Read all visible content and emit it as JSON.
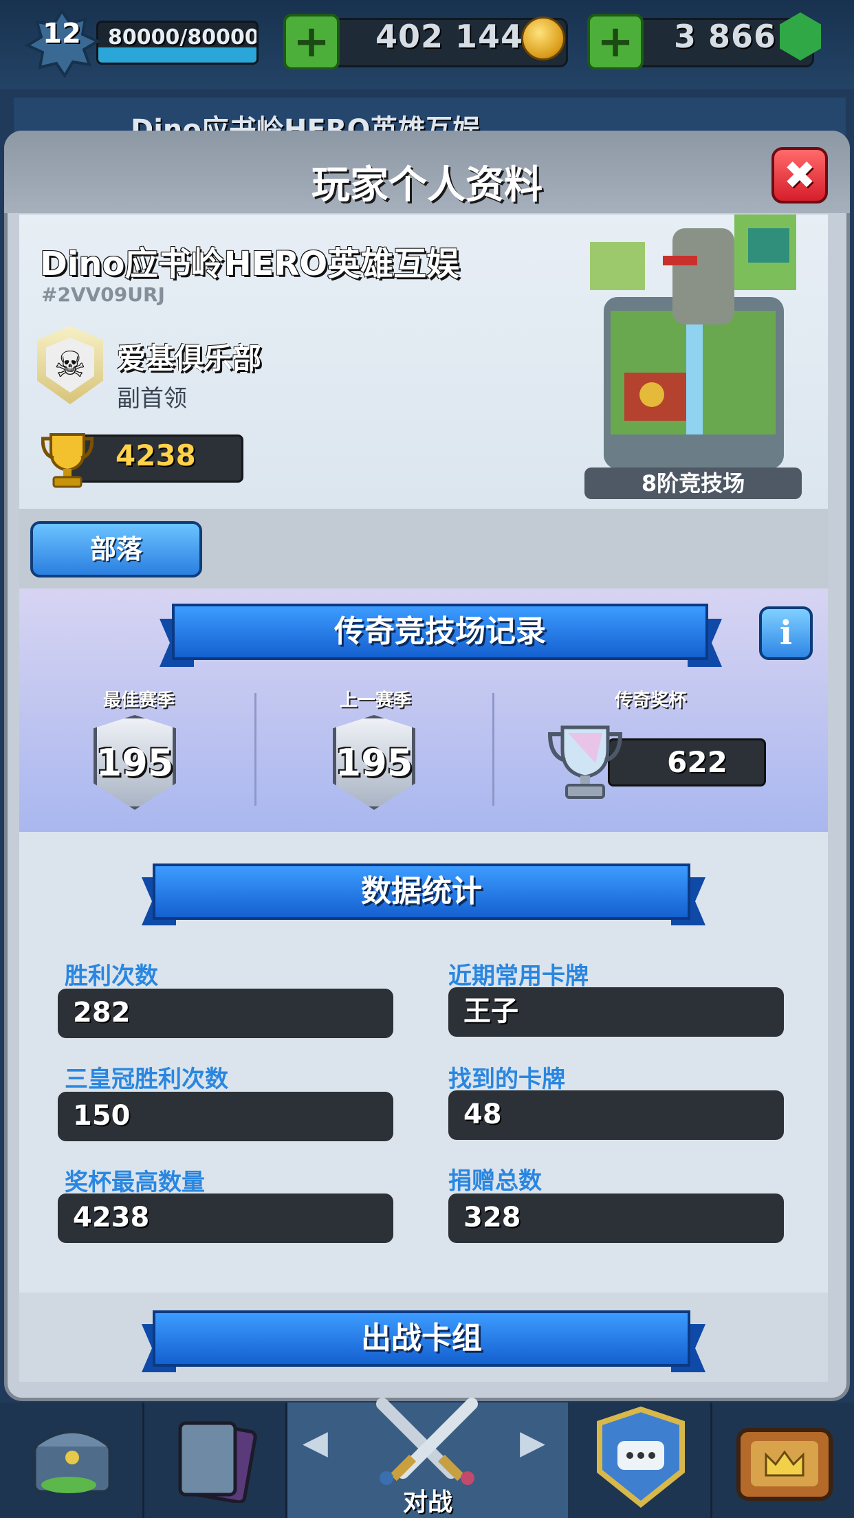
{
  "top_bar": {
    "level": "12",
    "xp_text": "80000/80000",
    "xp_progress": 1.0,
    "gold": "402 144",
    "gems": "3 866",
    "add_gold_label": "+",
    "add_gems_label": "+"
  },
  "background_strip": {
    "name_text": "Dino应书岭HERO英雄互娱"
  },
  "modal": {
    "title": "玩家个人资料",
    "close_label": "✖"
  },
  "profile": {
    "player_name": "Dino应书岭HERO英雄互娱",
    "player_tag": "#2VV09URJ",
    "clan_name": "爱基俱乐部",
    "clan_role": "副首领",
    "clan_icon": "skull-icon",
    "trophies": "4238",
    "arena_label": "8阶竞技场"
  },
  "tribe_button": "部落",
  "legend_arena": {
    "title": "传奇竞技场记录",
    "info_label": "i",
    "best_season_label": "最佳赛季",
    "best_season_value": "195",
    "last_season_label": "上一赛季",
    "last_season_value": "195",
    "legend_trophy_label": "传奇奖杯",
    "legend_trophy_value": "622"
  },
  "stats": {
    "title": "数据统计",
    "items": [
      {
        "label": "胜利次数",
        "value": "282"
      },
      {
        "label": "近期常用卡牌",
        "value": "王子"
      },
      {
        "label": "三皇冠胜利次数",
        "value": "150"
      },
      {
        "label": "找到的卡牌",
        "value": "48"
      },
      {
        "label": "奖杯最高数量",
        "value": "4238"
      },
      {
        "label": "捐赠总数",
        "value": "328"
      }
    ]
  },
  "deck": {
    "title": "出战卡组"
  },
  "bottom_nav": {
    "battle_label": "对战",
    "left_arrow": "◀",
    "right_arrow": "▶"
  },
  "colors": {
    "accent_blue": "#2a86e0",
    "close_red": "#d61e2c",
    "plus_green": "#4caf3a",
    "trophy_gold": "#ffd24a"
  }
}
